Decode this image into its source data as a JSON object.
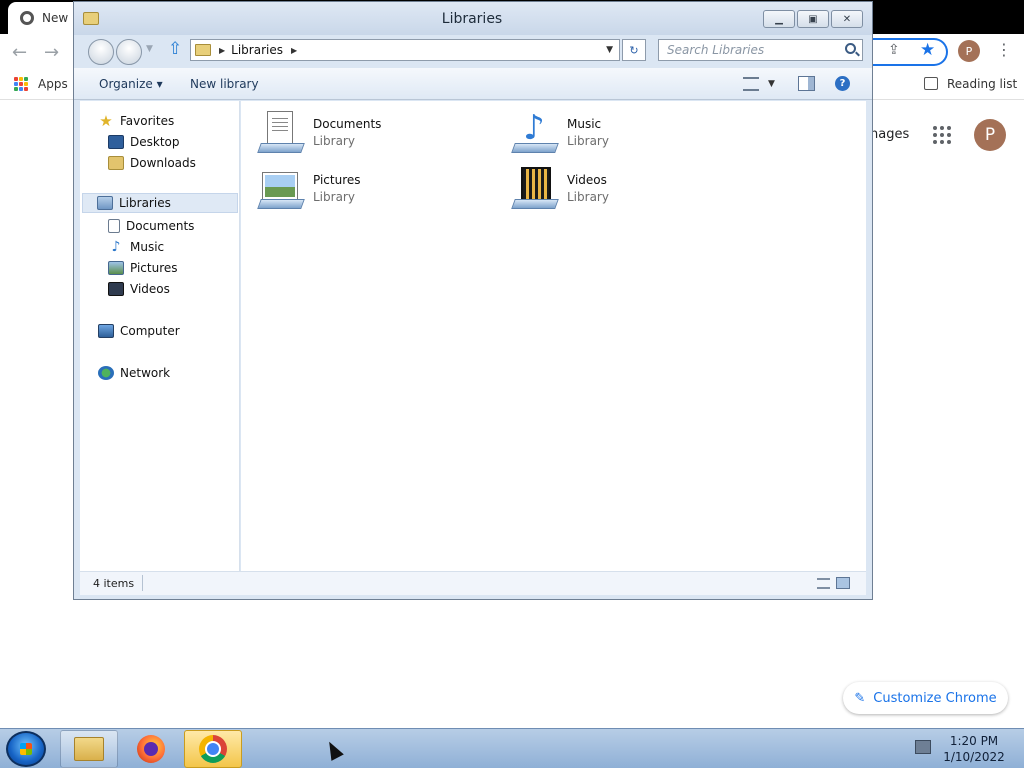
{
  "browser": {
    "tab_title": "New",
    "bookmarks": {
      "apps_label": "Apps",
      "reading_list_label": "Reading list"
    },
    "profile_initial": "P",
    "images_link": "nages",
    "customize_label": "Customize Chrome",
    "apps_grid_colors": [
      "#ea4335",
      "#fbbc05",
      "#34a853",
      "#4285f4",
      "#ea4335",
      "#fbbc05",
      "#34a853",
      "#4285f4",
      "#ea4335"
    ]
  },
  "explorer": {
    "title": "Libraries",
    "address": "Libraries",
    "search_placeholder": "Search Libraries",
    "commands": {
      "organize": "Organize ▾",
      "new_library": "New library"
    },
    "nav": {
      "favorites": "Favorites",
      "desktop": "Desktop",
      "downloads": "Downloads",
      "libraries": "Libraries",
      "documents": "Documents",
      "music": "Music",
      "pictures": "Pictures",
      "videos": "Videos",
      "computer": "Computer",
      "network": "Network"
    },
    "libraries": [
      {
        "name": "Documents",
        "type": "Library",
        "icon": "documents-library-icon"
      },
      {
        "name": "Music",
        "type": "Library",
        "icon": "music-library-icon"
      },
      {
        "name": "Pictures",
        "type": "Library",
        "icon": "pictures-library-icon"
      },
      {
        "name": "Videos",
        "type": "Library",
        "icon": "videos-library-icon"
      }
    ],
    "status": "4 items"
  },
  "taskbar": {
    "time": "1:20 PM",
    "date": "1/10/2022",
    "buttons": [
      "windows-explorer",
      "firefox",
      "google-chrome"
    ]
  }
}
